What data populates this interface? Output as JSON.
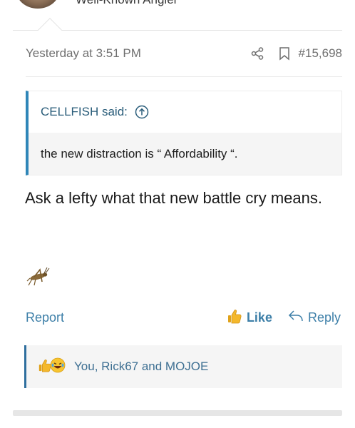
{
  "author": {
    "user_title": "Well-Known Angler"
  },
  "post": {
    "timestamp": "Yesterday at 3:51 PM",
    "number": "#15,698",
    "quote": {
      "author": "CELLFISH said:",
      "text": "the new distraction is “ Affordability “."
    },
    "message": "Ask a lefty what that new battle cry means.",
    "actions": {
      "report": "Report",
      "like": "Like",
      "reply": "Reply"
    },
    "reactions": {
      "text": "You, Rick67 and MOJOE",
      "icons": [
        "thumbs-up-icon",
        "laughing-emoji-icon"
      ]
    }
  },
  "colors": {
    "link": "#3d7fa8",
    "quote_border": "#2f86b8",
    "reaction_border": "#2f6f9e"
  }
}
